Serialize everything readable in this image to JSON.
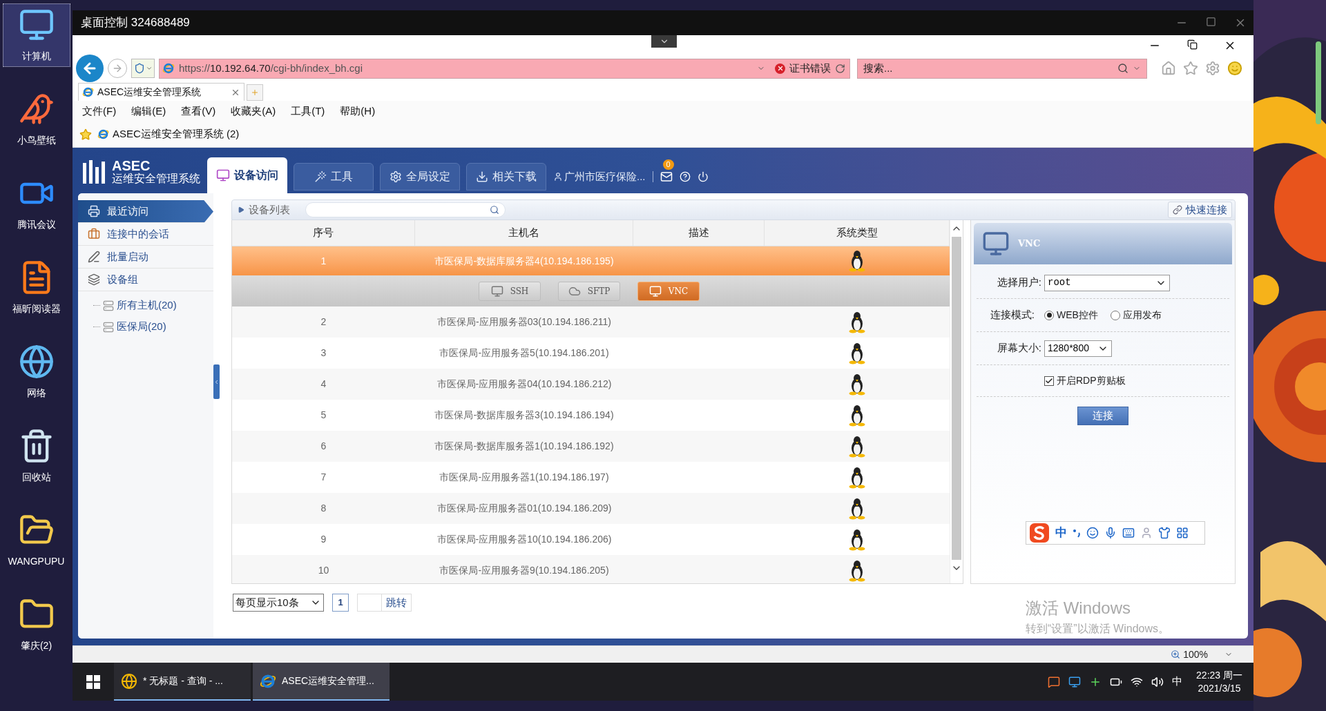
{
  "desktop": {
    "icons": [
      {
        "label": "计算机",
        "selected": true
      },
      {
        "label": "小鸟壁纸",
        "selected": false
      },
      {
        "label": "腾讯会议",
        "selected": false
      },
      {
        "label": "福昕阅读器",
        "selected": false
      },
      {
        "label": "网络",
        "selected": false
      },
      {
        "label": "回收站",
        "selected": false
      },
      {
        "label": "WANGPUPU",
        "selected": false
      },
      {
        "label": "肇庆(2)",
        "selected": false
      }
    ]
  },
  "remote_window": {
    "title": "桌面控制 324688489"
  },
  "browser": {
    "address": "https://**10.192.64.70**/cgi-bh/index_bh.cgi",
    "cert_error": "证书错误",
    "search_placeholder": "搜索...",
    "tabs": [
      {
        "label": "ASEC运维安全管理系统",
        "selected": true
      }
    ],
    "menu": [
      "文件(F)",
      "编辑(E)",
      "查看(V)",
      "收藏夹(A)",
      "工具(T)",
      "帮助(H)"
    ],
    "favorites": [
      "ASEC运维安全管理系统 (2)"
    ],
    "zoom": "100%"
  },
  "app": {
    "logo": {
      "name": "ASEC",
      "subtitle": "运维安全管理系统"
    },
    "nav_tabs": [
      {
        "label": "设备访问",
        "selected": true
      },
      {
        "label": "工具",
        "selected": false
      },
      {
        "label": "全局设定",
        "selected": false
      },
      {
        "label": "相关下载",
        "selected": false
      }
    ],
    "user": "广州市医疗保险...",
    "mail_badge": "0",
    "sidebar": {
      "items": [
        {
          "label": "最近访问",
          "selected": true
        },
        {
          "label": "连接中的会话",
          "selected": false
        },
        {
          "label": "批量启动",
          "selected": false
        },
        {
          "label": "设备组",
          "selected": false
        }
      ],
      "tree": [
        {
          "label": "所有主机(20)"
        },
        {
          "label": "医保局(20)"
        }
      ]
    },
    "device_list": {
      "title": "设备列表",
      "quick_connect": "快速连接",
      "columns": [
        "序号",
        "主机名",
        "描述",
        "系统类型"
      ],
      "rows": [
        {
          "no": "1",
          "host": "市医保局-数据库服务器4(10.194.186.195)",
          "selected": true
        },
        {
          "no": "2",
          "host": "市医保局-应用服务器03(10.194.186.211)",
          "selected": false
        },
        {
          "no": "3",
          "host": "市医保局-应用服务器5(10.194.186.201)",
          "selected": false
        },
        {
          "no": "4",
          "host": "市医保局-应用服务器04(10.194.186.212)",
          "selected": false
        },
        {
          "no": "5",
          "host": "市医保局-数据库服务器3(10.194.186.194)",
          "selected": false
        },
        {
          "no": "6",
          "host": "市医保局-数据库服务器1(10.194.186.192)",
          "selected": false
        },
        {
          "no": "7",
          "host": "市医保局-应用服务器1(10.194.186.197)",
          "selected": false
        },
        {
          "no": "8",
          "host": "市医保局-应用服务器01(10.194.186.209)",
          "selected": false
        },
        {
          "no": "9",
          "host": "市医保局-应用服务器10(10.194.186.206)",
          "selected": false
        },
        {
          "no": "10",
          "host": "市医保局-应用服务器9(10.194.186.205)",
          "selected": false
        }
      ],
      "actions": [
        {
          "label": "SSH",
          "selected": false
        },
        {
          "label": "SFTP",
          "selected": false
        },
        {
          "label": "VNC",
          "selected": true
        }
      ],
      "pagination": {
        "page_size": "每页显示10条",
        "page": "1",
        "jump": "跳转"
      }
    },
    "vnc_panel": {
      "title": "VNC",
      "user_label": "选择用户:",
      "user": "root",
      "mode_label": "连接模式:",
      "modes": [
        {
          "label": "WEB控件",
          "selected": true
        },
        {
          "label": "应用发布",
          "selected": false
        }
      ],
      "size_label": "屏幕大小:",
      "size": "1280*800",
      "clipboard": {
        "label": "开启RDP剪贴板",
        "checked": true
      },
      "connect": "连接"
    }
  },
  "ime_toolbar": {
    "mode": "中"
  },
  "activation": {
    "title": "激活 Windows",
    "text": "转到“设置”以激活 Windows。"
  },
  "taskbar": {
    "items": [
      {
        "label": "* 无标题 - 查询 - ...",
        "selected": false
      },
      {
        "label": "ASEC运维安全管理...",
        "selected": true
      }
    ],
    "ime": "中",
    "time": "22:23 周一",
    "date": "2021/3/15"
  }
}
